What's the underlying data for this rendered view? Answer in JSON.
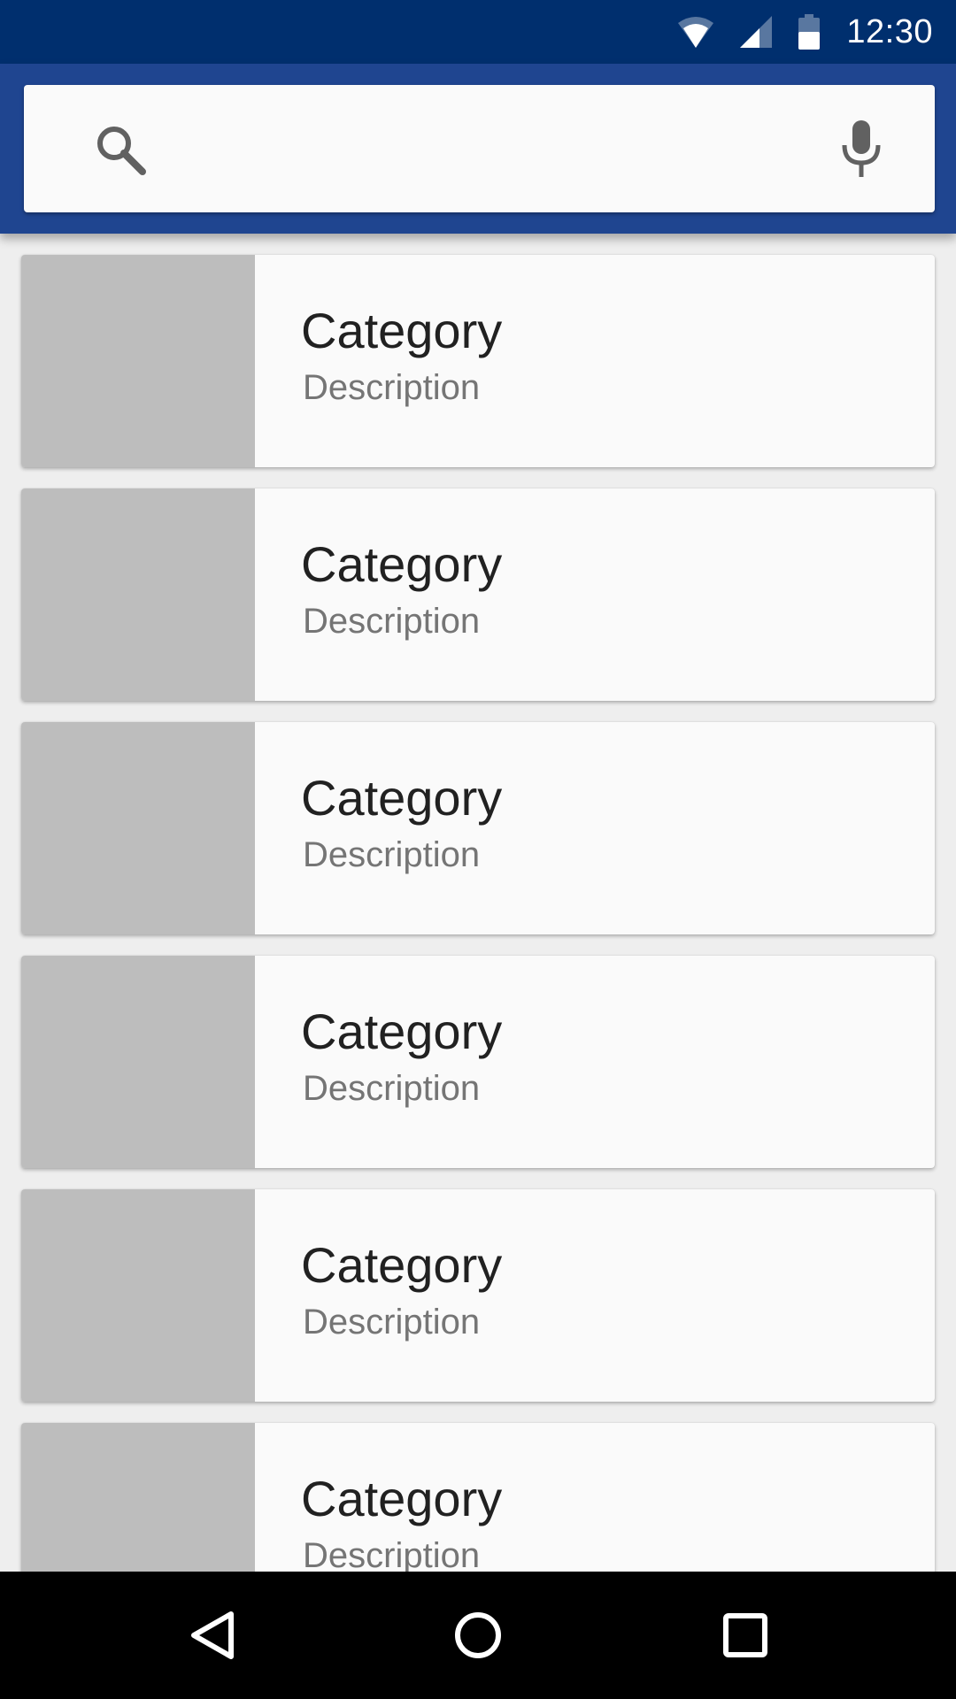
{
  "status_bar": {
    "time": "12:30",
    "icons": [
      "wifi-icon",
      "cell-signal-icon",
      "battery-icon"
    ],
    "background": "#002f6e"
  },
  "app_bar": {
    "background": "#1f4590",
    "search": {
      "placeholder": "",
      "value": "",
      "icons": [
        "search-icon",
        "mic-icon"
      ]
    }
  },
  "list": {
    "items": [
      {
        "title": "Category",
        "description": "Description"
      },
      {
        "title": "Category",
        "description": "Description"
      },
      {
        "title": "Category",
        "description": "Description"
      },
      {
        "title": "Category",
        "description": "Description"
      },
      {
        "title": "Category",
        "description": "Description"
      },
      {
        "title": "Category",
        "description": "Description"
      }
    ]
  },
  "nav_bar": {
    "buttons": [
      "back-icon",
      "home-icon",
      "recents-icon"
    ]
  }
}
